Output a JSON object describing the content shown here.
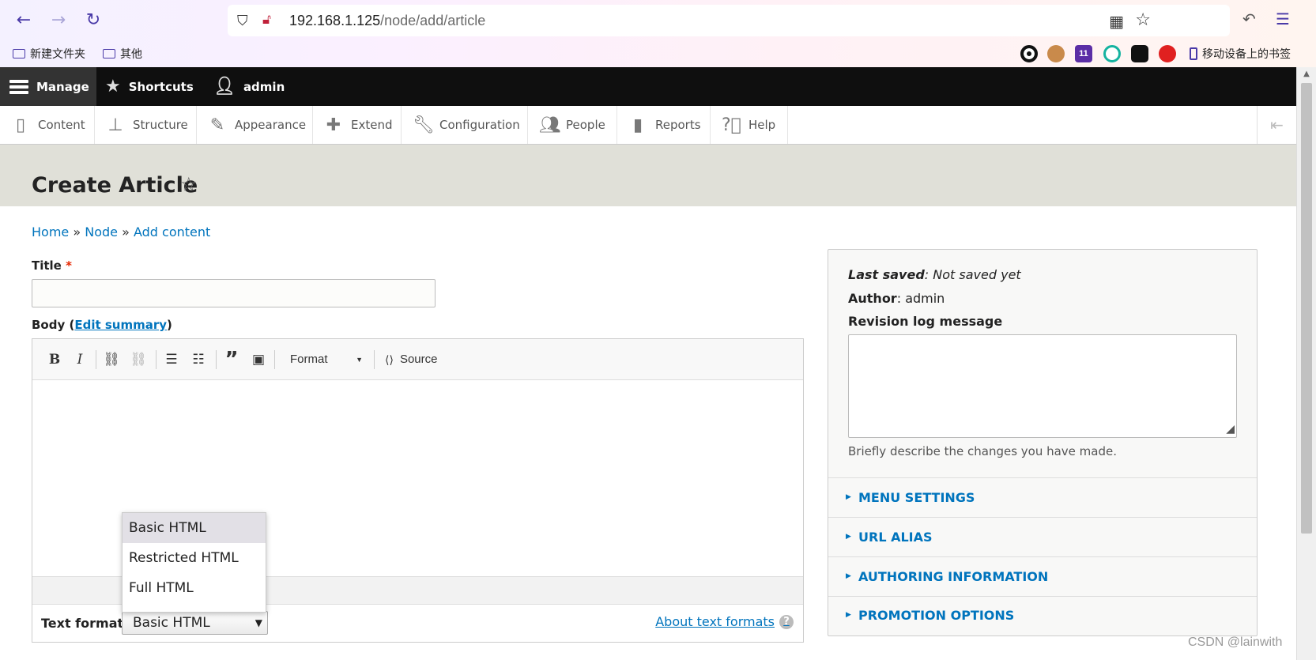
{
  "browser": {
    "url_host": "192.168.1.125",
    "url_path": "/node/add/article",
    "bookmarks": [
      "新建文件夹",
      "其他"
    ],
    "mobile_bookmarks": "移动设备上的书签",
    "extension_badge": "11"
  },
  "toolbar": {
    "manage": "Manage",
    "shortcuts": "Shortcuts",
    "user": "admin"
  },
  "tray": {
    "items": [
      "Content",
      "Structure",
      "Appearance",
      "Extend",
      "Configuration",
      "People",
      "Reports",
      "Help"
    ]
  },
  "page": {
    "title": "Create Article",
    "breadcrumb": [
      "Home",
      "Node",
      "Add content"
    ],
    "breadcrumb_sep": "»"
  },
  "form": {
    "title_label": "Title",
    "required_mark": "*",
    "body_label": "Body",
    "edit_summary": "Edit summary",
    "editor": {
      "bold": "B",
      "italic": "I",
      "format_label": "Format",
      "source_label": "Source"
    },
    "text_format_label": "Text format",
    "text_format_selected": "Basic HTML",
    "text_format_options": [
      "Basic HTML",
      "Restricted HTML",
      "Full HTML"
    ],
    "about_text_formats": "About text formats"
  },
  "sidebar": {
    "last_saved_label": "Last saved",
    "last_saved_value": "Not saved yet",
    "author_label": "Author",
    "author_value": "admin",
    "revision_label": "Revision log message",
    "revision_desc": "Briefly describe the changes you have made.",
    "sections": [
      "MENU SETTINGS",
      "URL ALIAS",
      "AUTHORING INFORMATION",
      "PROMOTION OPTIONS"
    ]
  },
  "watermark": "CSDN @lainwith"
}
